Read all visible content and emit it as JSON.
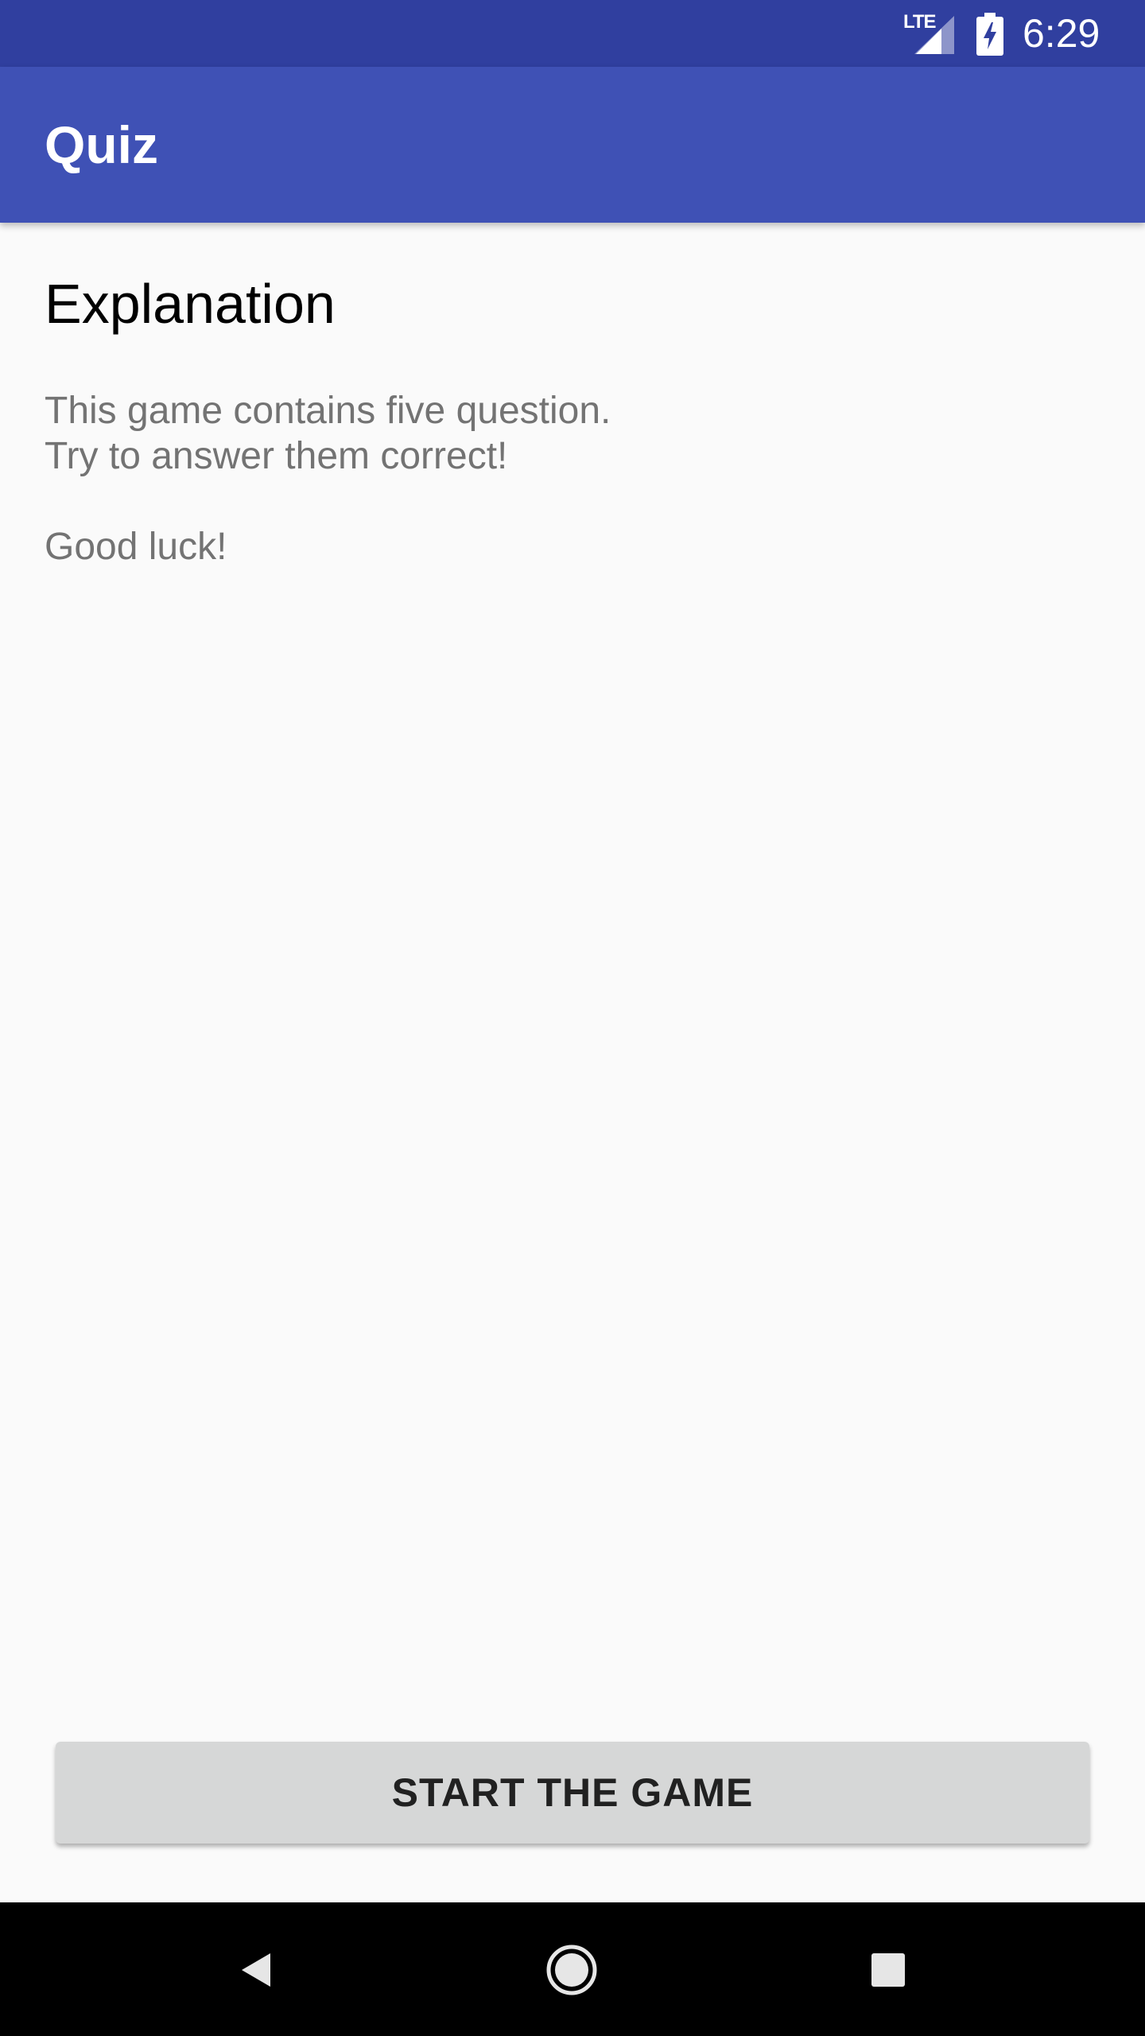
{
  "status_bar": {
    "network": "LTE",
    "time": "6:29",
    "icons": [
      "lte-signal-icon",
      "battery-charging-icon"
    ]
  },
  "app_bar": {
    "title": "Quiz"
  },
  "main": {
    "heading": "Explanation",
    "lines": [
      "This game contains five question.",
      "Try to answer them correct!",
      "Good luck!"
    ],
    "start_button_label": "START THE GAME"
  },
  "nav_bar": {
    "icons": [
      "back-icon",
      "home-icon",
      "recents-icon"
    ]
  },
  "colors": {
    "status_bar": "#303f9f",
    "app_bar": "#3f51b5",
    "background": "#fafafa",
    "button": "#d6d7d7",
    "body_text": "#737373"
  }
}
